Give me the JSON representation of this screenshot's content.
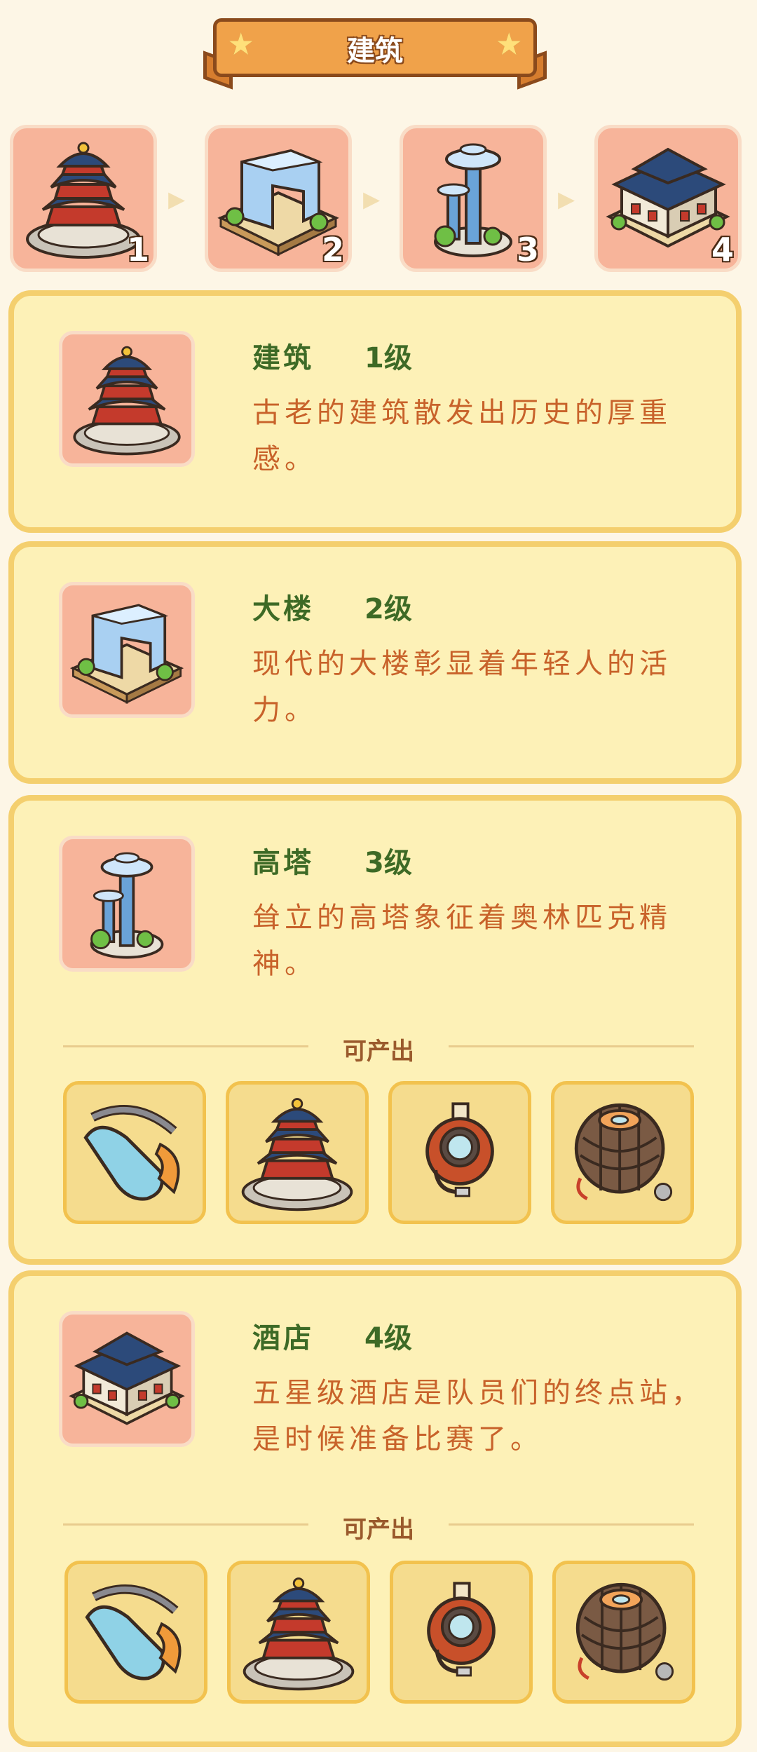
{
  "header": {
    "title": "建筑"
  },
  "chain": [
    {
      "num": "1",
      "icon": "temple-icon"
    },
    {
      "num": "2",
      "icon": "glass-building-icon"
    },
    {
      "num": "3",
      "icon": "tower-icon"
    },
    {
      "num": "4",
      "icon": "hotel-icon"
    }
  ],
  "cards": [
    {
      "name": "建筑",
      "level": "1级",
      "desc": "古老的建筑散发出历史的厚重感。"
    },
    {
      "name": "大楼",
      "level": "2级",
      "desc": "现代的大楼彰显着年轻人的活力。"
    },
    {
      "name": "高塔",
      "level": "3级",
      "desc": "耸立的高塔象征着奥林匹克精神。",
      "produces_label": "可产出"
    },
    {
      "name": "酒店",
      "level": "4级",
      "desc": "五星级酒店是队员们的终点站，是时候准备比赛了。",
      "produces_label": "可产出"
    }
  ],
  "products": [
    "goggles-icon",
    "temple-icon",
    "stopwatch-icon",
    "ball-icon"
  ]
}
